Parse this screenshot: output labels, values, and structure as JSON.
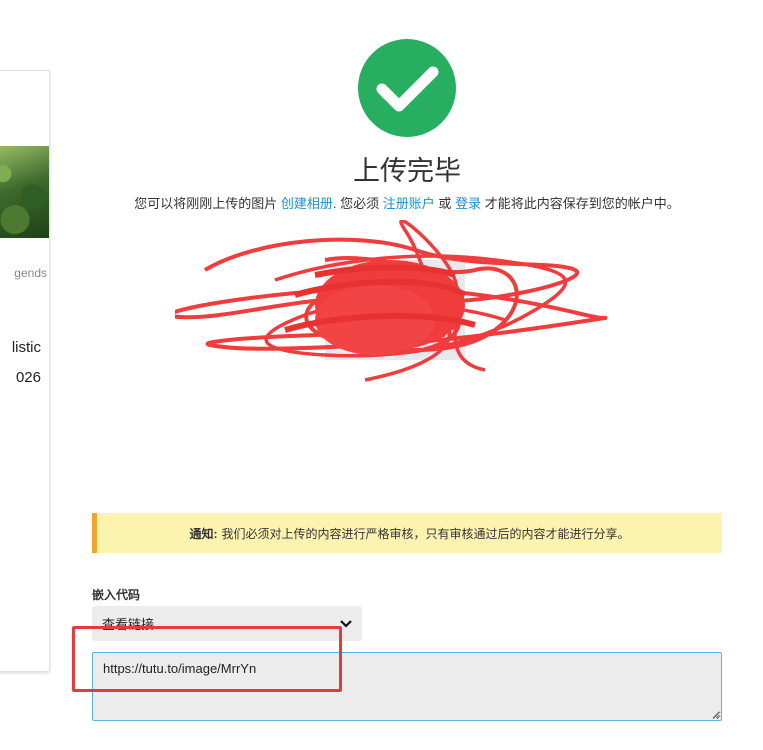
{
  "side_card": {
    "legend": "gends",
    "line1": "listic",
    "line2": "026"
  },
  "success": {
    "icon": "check-circle-icon",
    "color": "#27ae60"
  },
  "title": "上传完毕",
  "message": {
    "prefix": "您可以将刚刚上传的图片",
    "create_album": "创建相册",
    "middle": ". 您必须",
    "register": "注册账户",
    "or": "或",
    "login": "登录",
    "suffix": "才能将此内容保存到您的帐户中。"
  },
  "notice": {
    "label": "通知:",
    "text": "我们必须对上传的内容进行严格审核，只有审核通过后的内容才能进行分享。"
  },
  "embed": {
    "label": "嵌入代码",
    "select_value": "查看链接",
    "url": "https://tutu.to/image/MrrYn"
  },
  "colors": {
    "accent_link": "#1f8fd0",
    "notice_bg": "#fcf3b1",
    "notice_border": "#f2a52e",
    "annotation_red": "#e23d3d"
  }
}
